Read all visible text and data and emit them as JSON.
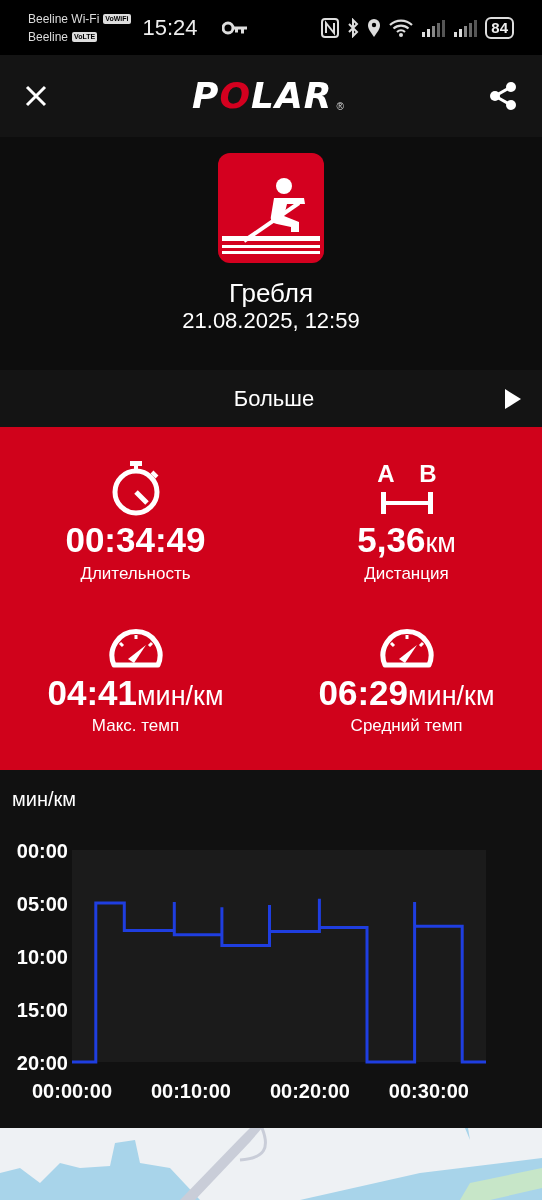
{
  "status_bar": {
    "carriers": [
      {
        "name": "Beeline Wi-Fi",
        "badge": "VoWiFi"
      },
      {
        "name": "Beeline",
        "badge": "VoLTE"
      }
    ],
    "time": "15:24",
    "battery": "84"
  },
  "app_bar": {
    "logo": "POLAR",
    "logo_mark": "®"
  },
  "activity": {
    "title": "Гребля",
    "datetime": "21.08.2025, 12:59"
  },
  "more_row": {
    "label": "Больше"
  },
  "distance_icon": {
    "start": "A",
    "end": "B"
  },
  "stats": [
    {
      "kind": "timer",
      "value": "00:34:49",
      "label": "Длительность"
    },
    {
      "kind": "distance",
      "value": "5,36",
      "unit": "км",
      "label": "Дистанция"
    },
    {
      "kind": "pace",
      "value": "04:41",
      "unit": "мин/км",
      "label": "Макс. темп"
    },
    {
      "kind": "pace",
      "value": "06:29",
      "unit": "мин/км",
      "label": "Средний темп"
    }
  ],
  "pace_chart": {
    "chart_data": {
      "type": "line",
      "ylabel": "мин/км",
      "x": [
        0,
        2,
        2,
        4.4,
        4.4,
        8.6,
        8.6,
        8.6,
        12.6,
        12.6,
        12.6,
        16.6,
        16.6,
        16.6,
        20.8,
        20.8,
        20.8,
        24.8,
        24.8,
        28.8,
        28.8,
        28.8,
        32.8,
        32.8,
        34.8
      ],
      "series": [
        {
          "color": "#1f3ee0",
          "values": [
            20,
            20,
            5,
            5,
            7.6,
            7.6,
            4.9,
            8,
            8,
            5.4,
            9,
            9,
            5.2,
            7.7,
            7.7,
            4.6,
            7.3,
            7.3,
            20,
            20,
            4.9,
            7.2,
            7.2,
            20,
            20
          ]
        }
      ],
      "xlim": [
        0,
        34.8
      ],
      "ylim": [
        20,
        0
      ],
      "xticks": [
        {
          "value": 0,
          "label": "00:00:00"
        },
        {
          "value": 10,
          "label": "00:10:00"
        },
        {
          "value": 20,
          "label": "00:20:00"
        },
        {
          "value": 30,
          "label": "00:30:00"
        }
      ],
      "yticks": [
        {
          "value": 0,
          "label": "00:00"
        },
        {
          "value": 5,
          "label": "05:00"
        },
        {
          "value": 10,
          "label": "10:00"
        },
        {
          "value": 15,
          "label": "15:00"
        },
        {
          "value": 20,
          "label": "20:00"
        }
      ]
    }
  }
}
